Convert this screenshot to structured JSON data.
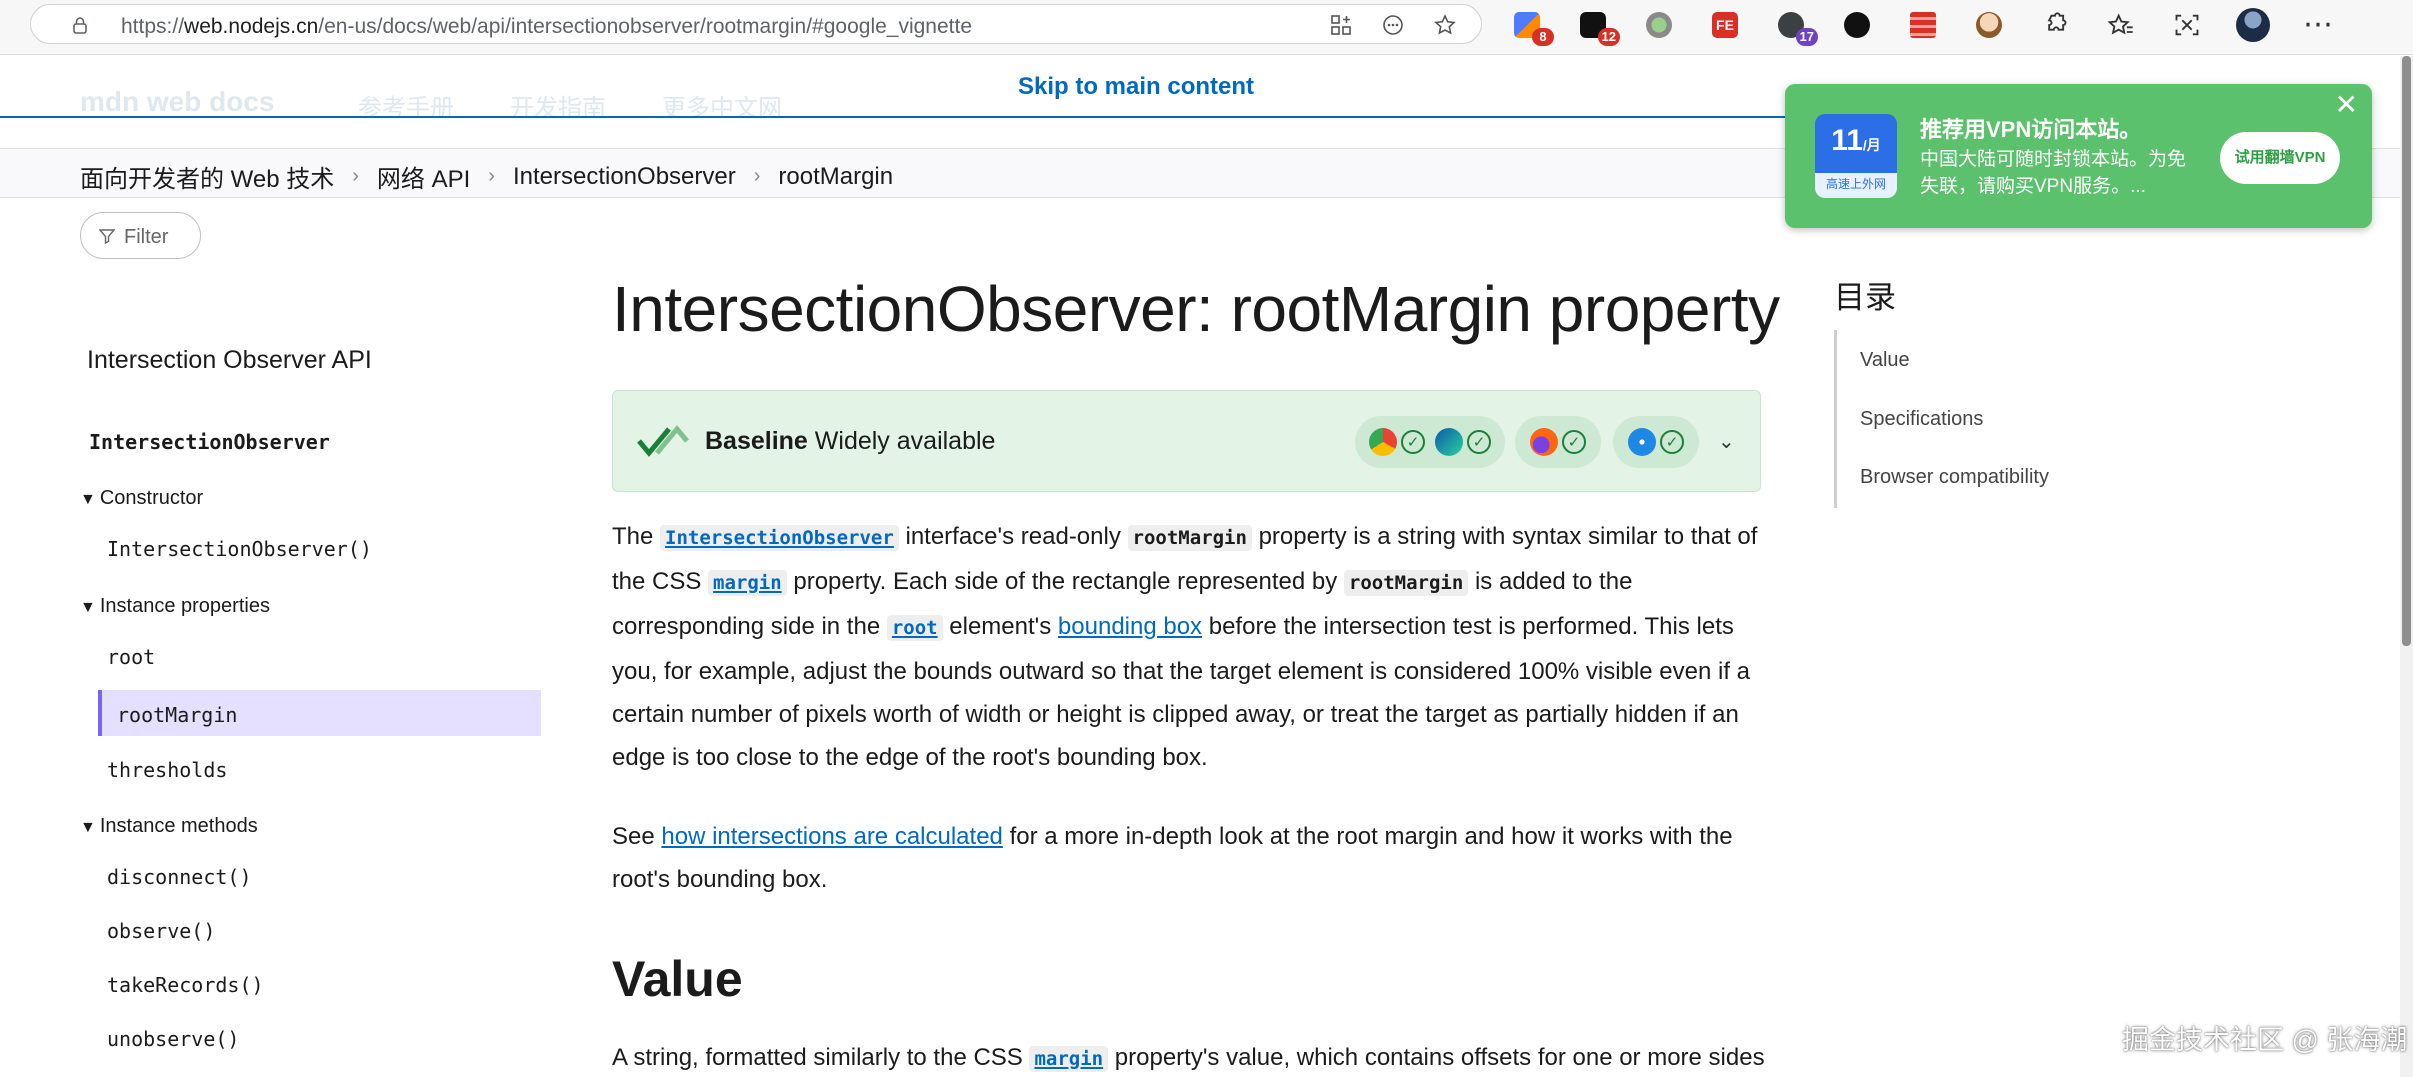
{
  "browser": {
    "url_prefix": "https://",
    "url_host": "web.nodejs.cn",
    "url_path": "/en-us/docs/web/api/intersectionobserver/rootmargin/#google_vignette",
    "extensions": [
      {
        "icon": "puzzle-grid-icon",
        "badge": "8",
        "badge_color": "#d93025"
      },
      {
        "icon": "chat-icon",
        "badge": "12",
        "badge_color": "#d93025"
      },
      {
        "icon": "circle-icon",
        "badge": "",
        "badge_color": ""
      },
      {
        "icon": "fe-icon",
        "label": "FE",
        "badge": "",
        "badge_color": ""
      },
      {
        "icon": "wordpress-icon",
        "badge": "17",
        "badge_color": "#6f42c1"
      },
      {
        "icon": "github-icon",
        "badge": "",
        "badge_color": ""
      },
      {
        "icon": "notes-icon",
        "badge": "",
        "badge_color": ""
      },
      {
        "icon": "face-icon",
        "badge": "",
        "badge_color": ""
      }
    ]
  },
  "header": {
    "logo": "mdn web docs",
    "nav": [
      "参考手册",
      "开发指南",
      "更多中文网"
    ],
    "skip_link": "Skip to main content"
  },
  "breadcrumb": [
    "面向开发者的 Web 技术",
    "网络 API",
    "IntersectionObserver",
    "rootMargin"
  ],
  "sidebar": {
    "filter": "Filter",
    "title": "Intersection Observer API",
    "root_item": "IntersectionObserver",
    "group_constructor": "Constructor",
    "constructor_items": [
      "IntersectionObserver()"
    ],
    "group_properties": "Instance properties",
    "property_items": [
      "root",
      "rootMargin",
      "thresholds"
    ],
    "group_methods": "Instance methods",
    "method_items": [
      "disconnect()",
      "observe()",
      "takeRecords()",
      "unobserve()"
    ]
  },
  "main": {
    "title": "IntersectionObserver: rootMargin property",
    "baseline_strong": "Baseline",
    "baseline_text": "Widely available",
    "p1": {
      "t1": "The ",
      "c1": "IntersectionObserver",
      "t2": " interface's read-only ",
      "c2": "rootMargin",
      "t3": " property is a string with syntax similar to that of the CSS ",
      "c3": "margin",
      "t4": " property. Each side of the rectangle represented by ",
      "c4": "rootMargin",
      "t5": " is added to the corresponding side in the ",
      "c5": "root",
      "t6": " element's ",
      "l1": "bounding box",
      "t7": " before the intersection test is performed. This lets you, for example, adjust the bounds outward so that the target element is considered 100% visible even if a certain number of pixels worth of width or height is clipped away, or treat the target as partially hidden if an edge is too close to the edge of the root's bounding box."
    },
    "p2": {
      "t1": "See ",
      "l1": "how intersections are calculated",
      "t2": " for a more in-depth look at the root margin and how it works with the root's bounding box."
    },
    "h2": "Value",
    "p3": {
      "t1": "A string, formatted similarly to the CSS ",
      "c1": "margin",
      "t2": " property's value, which contains offsets for one or more sides"
    }
  },
  "toc": {
    "title": "目录",
    "items": [
      "Value",
      "Specifications",
      "Browser compatibility"
    ]
  },
  "promo": {
    "img_num": "11",
    "img_unit": "/月",
    "img_caption": "高速上外网",
    "title": "推荐用VPN访问本站。",
    "desc": "中国大陆可随时封锁本站。为免失联，请购买VPN服务。...",
    "button": "试用翻墙VPN",
    "close": "✕"
  },
  "watermark": "掘金技术社区 @ 张海潮"
}
